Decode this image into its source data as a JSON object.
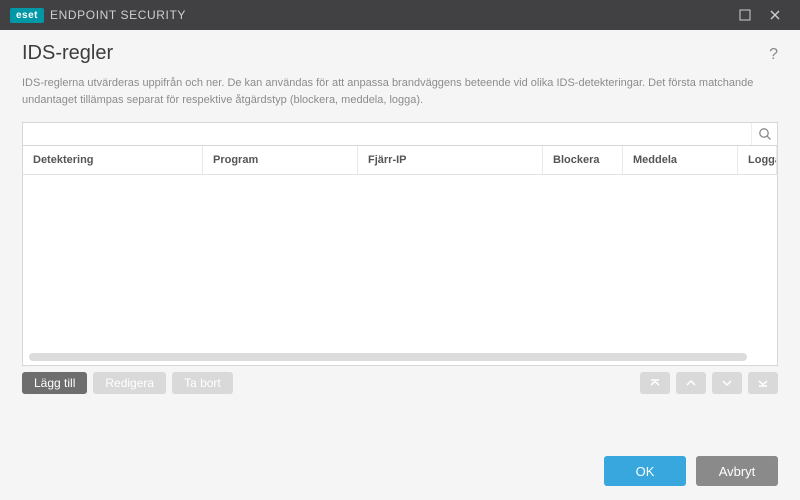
{
  "titlebar": {
    "brand_badge": "eset",
    "brand_text": "ENDPOINT SECURITY"
  },
  "header": {
    "title": "IDS-regler"
  },
  "description": "IDS-reglerna utvärderas uppifrån och ner. De kan användas för att anpassa brandväggens beteende vid olika IDS-detekteringar. Det första matchande undantaget tillämpas separat för respektive åtgärdstyp (blockera, meddela, logga).",
  "search": {
    "placeholder": ""
  },
  "table": {
    "columns": {
      "detection": "Detektering",
      "program": "Program",
      "remote_ip": "Fjärr-IP",
      "block": "Blockera",
      "notify": "Meddela",
      "log": "Logga"
    },
    "rows": []
  },
  "actions": {
    "add": "Lägg till",
    "edit": "Redigera",
    "delete": "Ta bort"
  },
  "footer": {
    "ok": "OK",
    "cancel": "Avbryt"
  }
}
